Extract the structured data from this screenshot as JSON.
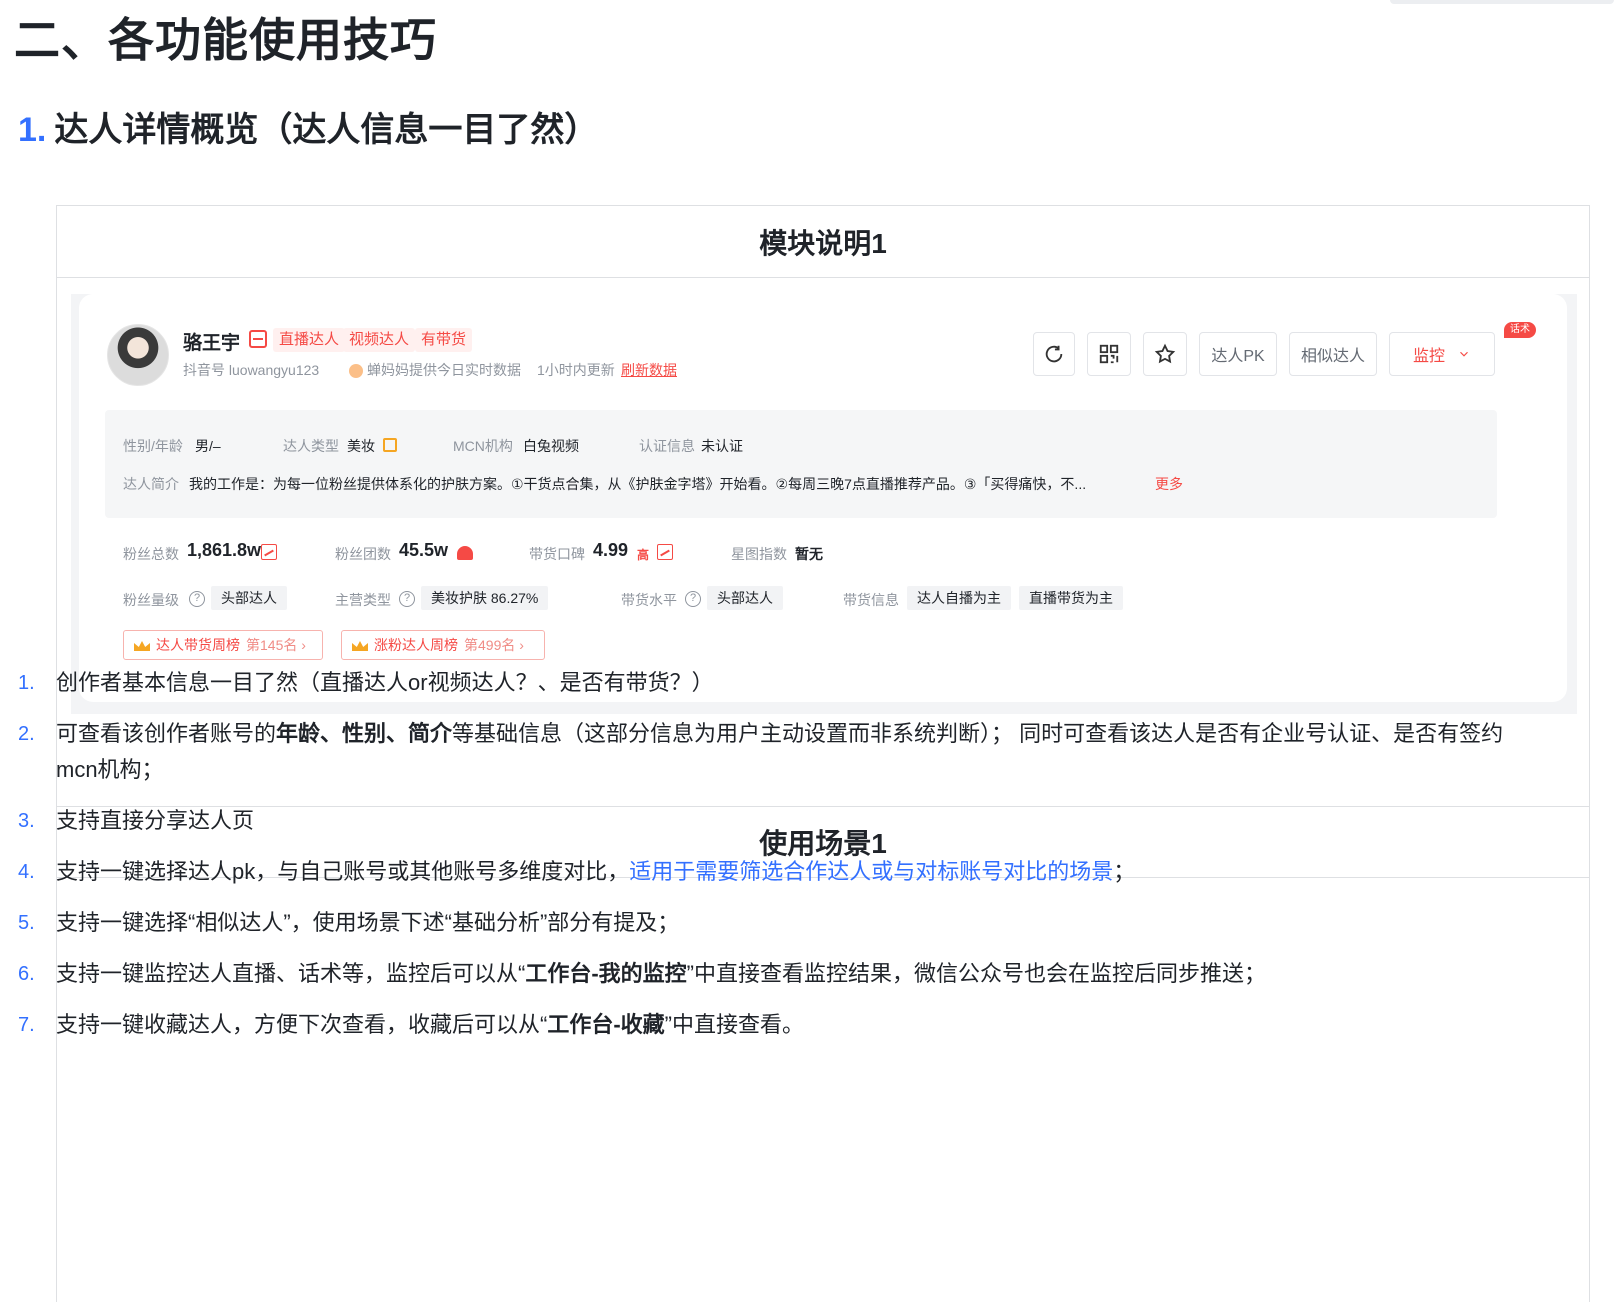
{
  "headings": {
    "h1": "二、各功能使用技巧",
    "h2_num": "1.",
    "h2_text": "达人详情概览（达人信息一目了然）"
  },
  "table": {
    "header1": "模块说明1",
    "header2": "使用场景1"
  },
  "profile": {
    "name": "骆王宇",
    "tags": [
      "直播达人",
      "视频达人",
      "有带货"
    ],
    "douyin_id": "抖音号 luowangyu123",
    "data_source": "蝉妈妈提供今日实时数据",
    "update_note": "1小时内更新",
    "refresh_link": "刷新数据",
    "buttons": {
      "pk": "达人PK",
      "similar": "相似达人",
      "monitor": "监控",
      "monitor_badge": "话术"
    },
    "icons": [
      "refresh-icon",
      "qrcode-icon",
      "star-icon",
      "chevron-down-icon"
    ]
  },
  "info": {
    "gender_age_label": "性别/年龄",
    "gender_age": "男/–",
    "type_label": "达人类型",
    "type": "美妆",
    "mcn_label": "MCN机构",
    "mcn": "白兔视频",
    "cert_label": "认证信息",
    "cert": "未认证",
    "intro_label": "达人简介",
    "intro": "我的工作是：为每一位粉丝提供体系化的护肤方案。①干货点合集，从《护肤金字塔》开始看。②每周三晚7点直播推荐产品。③「买得痛快，不...",
    "more": "更多"
  },
  "stats": {
    "fans_label": "粉丝总数",
    "fans": "1,861.8w",
    "group_label": "粉丝团数",
    "group": "45.5w",
    "rep_label": "带货口碑",
    "rep": "4.99",
    "rep_level": "高",
    "star_label": "星图指数",
    "star": "暂无",
    "fans_level_label": "粉丝量级",
    "fans_level": "头部达人",
    "main_type_label": "主营类型",
    "main_type": "美妆护肤 86.27%",
    "sell_level_label": "带货水平",
    "sell_level": "头部达人",
    "sell_info_label": "带货信息",
    "sell_info": [
      "达人自播为主",
      "直播带货为主"
    ],
    "rank1": "达人带货周榜",
    "rank1_pos": "第145名 ›",
    "rank2": "涨粉达人周榜",
    "rank2_pos": "第499名 ›"
  },
  "scenarios": [
    {
      "n": "1.",
      "parts": [
        {
          "t": "创作者基本信息一目了然（直播达人or视频达人？、是否有带货？）"
        }
      ]
    },
    {
      "n": "2.",
      "parts": [
        {
          "t": "可查看该创作者账号的"
        },
        {
          "t": "年龄、性别、简介",
          "b": true
        },
        {
          "t": "等基础信息（这部分信息为用户主动设置而非系统判断）； 同时可查看该达人是否有企业号认证、是否有签约mcn机构；"
        }
      ]
    },
    {
      "n": "3.",
      "parts": [
        {
          "t": "支持直接分享达人页"
        }
      ]
    },
    {
      "n": "4.",
      "parts": [
        {
          "t": "支持一键选择达人pk，与自己账号或其他账号多维度对比，"
        },
        {
          "t": "适用于需要筛选合作达人或与对标账号对比的场景",
          "blue": true
        },
        {
          "t": "；"
        }
      ]
    },
    {
      "n": "5.",
      "parts": [
        {
          "t": "支持一键选择“相似达人”，使用场景下述“基础分析”部分有提及；"
        }
      ]
    },
    {
      "n": "6.",
      "parts": [
        {
          "t": "支持一键监控达人直播、话术等，监控后可以从“"
        },
        {
          "t": "工作台-我的监控",
          "b": true
        },
        {
          "t": "”中直接查看监控结果，微信公众号也会在监控后同步推送；"
        }
      ]
    },
    {
      "n": "7.",
      "parts": [
        {
          "t": "支持一键收藏达人，方便下次查看，收藏后可以从“"
        },
        {
          "t": "工作台-收藏",
          "b": true
        },
        {
          "t": "”中直接查看。"
        }
      ]
    }
  ]
}
